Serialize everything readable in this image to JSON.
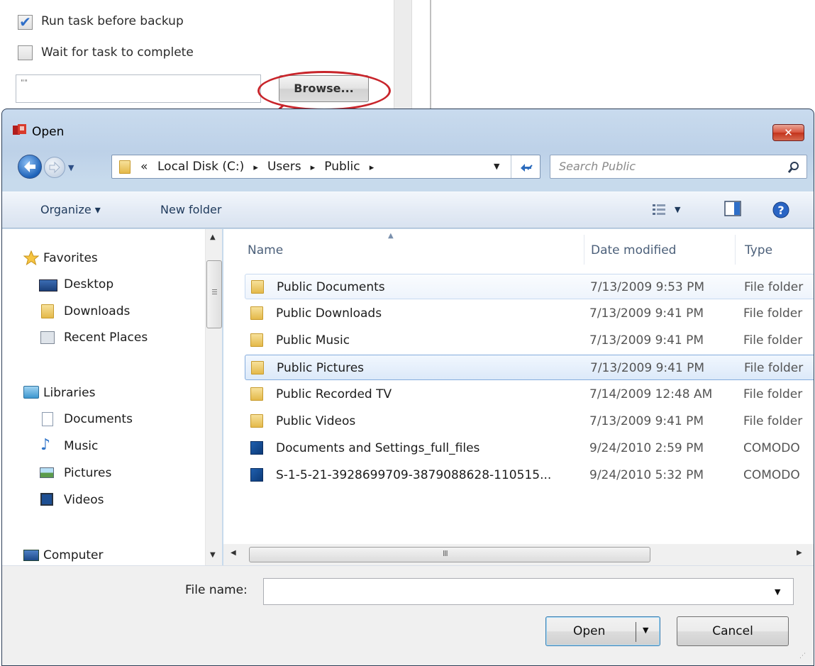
{
  "background_panel": {
    "run_task_label": "Run task before backup",
    "run_task_checked": true,
    "wait_task_label": "Wait for task to complete",
    "wait_task_checked": false,
    "path_value": "\"\"",
    "browse_label": "Browse..."
  },
  "dialog": {
    "title": "Open",
    "close_glyph": "✕",
    "address": {
      "overflow": "«",
      "segments": [
        "Local Disk (C:)",
        "Users",
        "Public"
      ],
      "separator": "▸"
    },
    "search_placeholder": "Search Public",
    "toolbar": {
      "organize_label": "Organize ▾",
      "new_folder_label": "New folder"
    },
    "nav": {
      "favorites_header": "Favorites",
      "favorites": [
        "Desktop",
        "Downloads",
        "Recent Places"
      ],
      "libraries_header": "Libraries",
      "libraries": [
        "Documents",
        "Music",
        "Pictures",
        "Videos"
      ],
      "computer_header": "Computer"
    },
    "columns": {
      "name": "Name",
      "date": "Date modified",
      "type": "Type"
    },
    "files": [
      {
        "name": "Public Documents",
        "date": "7/13/2009 9:53 PM",
        "type": "File folder",
        "icon": "folder-icon"
      },
      {
        "name": "Public Downloads",
        "date": "7/13/2009 9:41 PM",
        "type": "File folder",
        "icon": "folder-icon"
      },
      {
        "name": "Public Music",
        "date": "7/13/2009 9:41 PM",
        "type": "File folder",
        "icon": "folder-icon"
      },
      {
        "name": "Public Pictures",
        "date": "7/13/2009 9:41 PM",
        "type": "File folder",
        "icon": "folder-icon"
      },
      {
        "name": "Public Recorded TV",
        "date": "7/14/2009 12:48 AM",
        "type": "File folder",
        "icon": "folder-icon"
      },
      {
        "name": "Public Videos",
        "date": "7/13/2009 9:41 PM",
        "type": "File folder",
        "icon": "folder-icon"
      },
      {
        "name": "Documents and Settings_full_files",
        "date": "9/24/2010 2:59 PM",
        "type": "COMODO",
        "icon": "comodo-backup-icon"
      },
      {
        "name": "S-1-5-21-3928699709-3879088628-110515...",
        "date": "9/24/2010 5:32 PM",
        "type": "COMODO",
        "icon": "comodo-backup-icon"
      }
    ],
    "hscroll_grip": "III",
    "filename_label": "File name:",
    "filename_value": "",
    "open_label": "Open",
    "cancel_label": "Cancel"
  },
  "colors": {
    "highlight_ellipse": "#c8252b",
    "arrow": "#c8252b",
    "selection_border": "#84acdd",
    "checkbox_check": "#2f6fc8"
  }
}
